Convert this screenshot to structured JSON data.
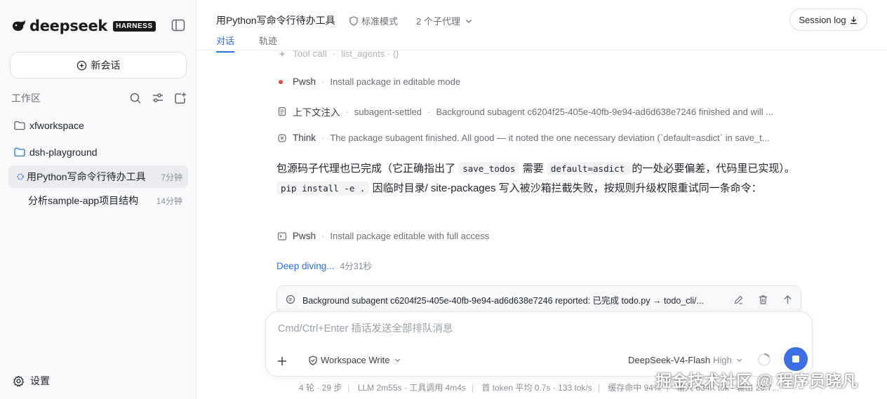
{
  "brand": {
    "name": "deepseek",
    "badge": "HARNESS"
  },
  "sidebar": {
    "new_chat": "新会话",
    "workspace_title": "工作区",
    "folders": [
      {
        "label": "xfworkspace"
      },
      {
        "label": "dsh-playground"
      }
    ],
    "threads": [
      {
        "label": "用Python写命令行待办工具",
        "time": "7分钟"
      },
      {
        "label": "分析sample-app项目结构",
        "time": "14分钟"
      }
    ],
    "settings": "设置"
  },
  "header": {
    "title": "用Python写命令行待办工具",
    "mode": "标准模式",
    "agents": "2 个子代理",
    "session_log": "Session log",
    "tabs": [
      {
        "label": "对话"
      },
      {
        "label": "轨迹"
      }
    ]
  },
  "steps": [
    {
      "name": "Tool call",
      "desc": "list_agents · {}"
    },
    {
      "name": "Pwsh",
      "desc": "Install package in editable mode"
    },
    {
      "name": "上下文注入",
      "desc": "subagent-settled",
      "desc2": "Background subagent c6204f25-405e-40fb-9e94-ad6d638e7246 finished and will ..."
    },
    {
      "name": "Think",
      "desc": "The package subagent finished. All good — it noted the one necessary deviation (`default=asdict` in save_t..."
    }
  ],
  "message": {
    "p1": "包源码子代理也已完成（它正确指出了",
    "code1": "save_todos",
    "p2": "需要",
    "code2": "default=asdict",
    "p3": "的一处必要偏差，代码里已实现）。",
    "code3": "pip install -e .",
    "p4": "因临时目录/ site-packages 写入被沙箱拦截失败，按规则升级权限重试同一条命令："
  },
  "step_after": {
    "name": "Pwsh",
    "desc": "Install package editable with full access"
  },
  "deep_diving": {
    "label": "Deep diving...",
    "time": "4分31秒"
  },
  "queued": {
    "text": "Background subagent c6204f25-405e-40fb-9e94-ad6d638e7246 reported: 已完成 todo.py → todo_cli/..."
  },
  "composer": {
    "placeholder": "Cmd/Ctrl+Enter 插话发送全部排队消息",
    "permission": "Workspace Write",
    "model": "DeepSeek-V4-Flash",
    "level": "High"
  },
  "stats": [
    "4 轮 · 29 步",
    "LLM 2m55s · 工具调用 4m4s",
    "首 token 平均 0.7s · 133 tok/s",
    "缓存命中 94%",
    "输入 634K tok · 输出 20.7..."
  ],
  "watermark": "掘金技术社区 @ 程序员晓凡",
  "colors": {
    "accent": "#2f6fe0",
    "stop_button": "#3e6ee6",
    "pwsh_dot": "#e5484d"
  }
}
